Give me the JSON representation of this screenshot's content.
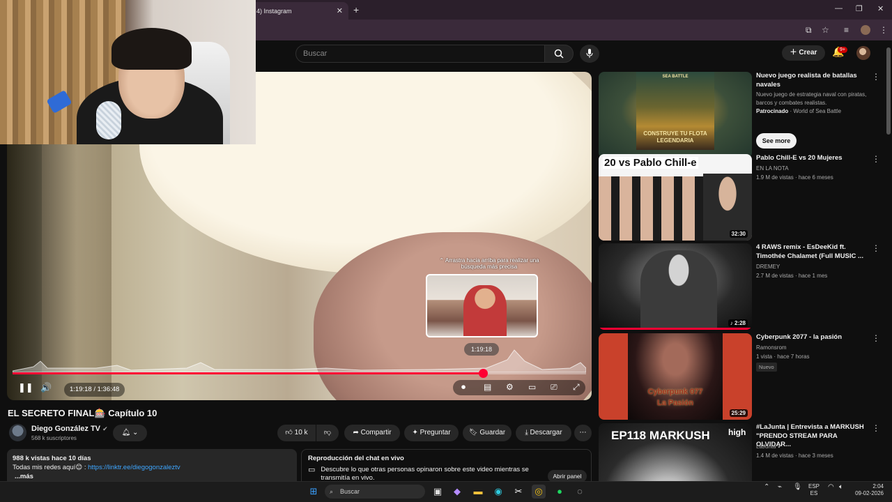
{
  "browser": {
    "tab_label": "4) Instagram",
    "tab_close": "✕",
    "new_tab": "+",
    "minimize": "—",
    "restore": "❐",
    "close": "✕"
  },
  "header": {
    "search_placeholder": "Buscar",
    "create_label": "Crear",
    "notif_count": "9+"
  },
  "player": {
    "drag_hint": "⌃ Arrastra hacia arriba para realizar una búsqueda más precisa",
    "preview_time": "1:19:18",
    "current_time": "1:19:18",
    "duration": "1:36:48",
    "timecode": "1:19:18 / 1:36:48",
    "progress_fraction": 0.82,
    "accent": "#ff0033"
  },
  "video": {
    "title": "EL SECRETO FINAL🎰 Capítulo 10",
    "channel_name": "Diego González TV",
    "subscribers": "568 k suscriptores",
    "likes": "10 k",
    "share_label": "Compartir",
    "ask_label": "Preguntar",
    "save_label": "Guardar",
    "download_label": "Descargar"
  },
  "description": {
    "stats": "988 k vistas  hace 10 días",
    "line1_prefix": "Todas mis redes aquí😊 : ",
    "link": "https://linktr.ee/diegogonzaleztv",
    "more": "...más"
  },
  "chat": {
    "title": "Reproducción del chat en vivo",
    "text": "Descubre lo que otras personas opinaron sobre este video mientras se transmitía en vivo.",
    "button": "Abrir panel"
  },
  "recommendations": [
    {
      "title": "Nuevo juego realista de batallas navales",
      "desc": "Nuevo juego de estrategia naval con piratas, barcos y combates realistas.",
      "sponsored": "Patrocinado",
      "advertiser": "World of Sea Battle",
      "cta": "See more",
      "thumb_top": "SEA BATTLE",
      "thumb_bottom": "CONSTRUYE TU FLOTA LEGENDARIA"
    },
    {
      "title": "Pablo Chill-E vs 20 Mujeres",
      "channel": "EN LA NOTA",
      "meta": "1.9 M de vistas · hace 6 meses",
      "duration": "32:30",
      "thumb_text": "20 vs Pablo Chill-e"
    },
    {
      "title": "4 RAWS remix - EsDeeKid ft. Timothée Chalamet (Full MUSIC ...",
      "channel": "DREMEY",
      "meta": "2.7 M de vistas · hace 1 mes",
      "duration": "♪ 2:28"
    },
    {
      "title": "Cyberpunk 2077 - la pasión",
      "channel": "Ramonsrom",
      "meta": "1 vista · hace 7 horas",
      "badge": "Nuevo",
      "duration": "25:29",
      "thumb_text1": "Cyberpunk 077",
      "thumb_text2": "La Pasión"
    },
    {
      "title": "#LaJunta | Entrevista a MARKUSH \"PRENDO STREAM PARA OLVIDAR...",
      "channel": "LaJunta",
      "meta": "1.4 M de vistas · hace 3 meses",
      "thumb_text": "EP118 MARKUSH",
      "thumb_logo": "high"
    }
  ],
  "taskbar": {
    "search_label": "Buscar",
    "lang1": "ESP",
    "lang2": "ES",
    "time": "2:04",
    "date": "09-02-2026"
  },
  "icons": {
    "search": "search-icon",
    "mic": "mic-icon",
    "bell": "bell-icon",
    "menu": "more-vert-icon"
  }
}
